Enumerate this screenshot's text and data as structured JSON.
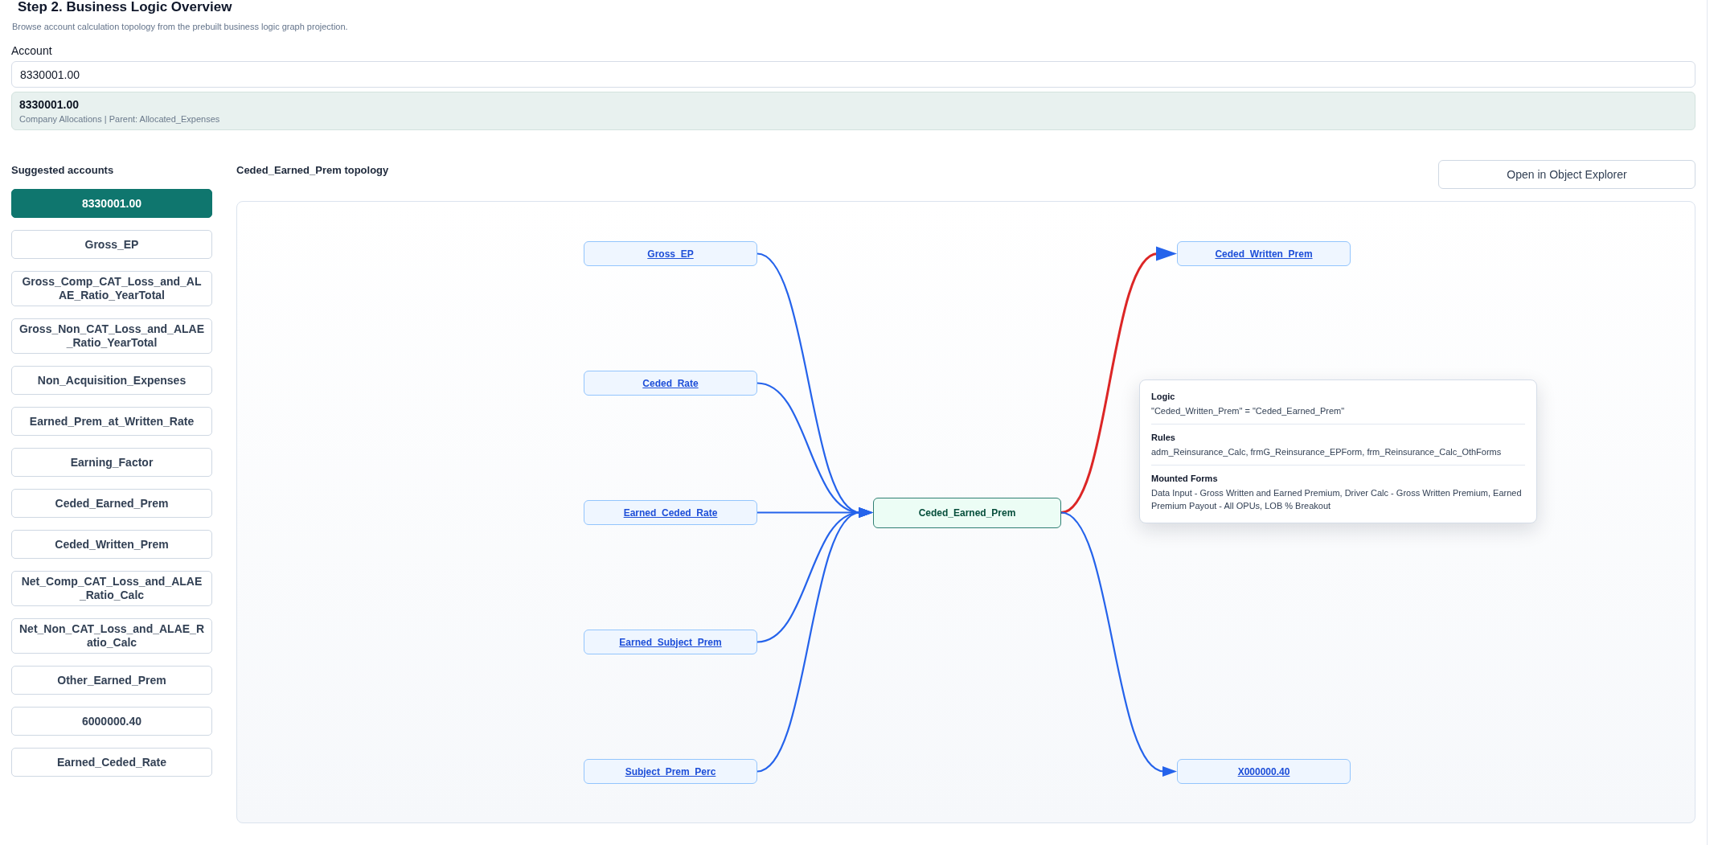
{
  "page": {
    "title": "Step 2. Business Logic Overview",
    "subtitle": "Browse account calculation topology from the prebuilt business logic graph projection."
  },
  "account": {
    "label": "Account",
    "value": "8330001.00",
    "match": {
      "name": "8330001.00",
      "detail": "Company Allocations | Parent: Allocated_Expenses"
    }
  },
  "suggested_accounts": {
    "heading": "Suggested accounts",
    "items": [
      {
        "label": "8330001.00",
        "selected": true
      },
      {
        "label": "Gross_EP",
        "selected": false
      },
      {
        "label": "Gross_Comp_CAT_Loss_and_ALAE_Ratio_YearTotal",
        "selected": false
      },
      {
        "label": "Gross_Non_CAT_Loss_and_ALAE_Ratio_YearTotal",
        "selected": false
      },
      {
        "label": "Non_Acquisition_Expenses",
        "selected": false
      },
      {
        "label": "Earned_Prem_at_Written_Rate",
        "selected": false
      },
      {
        "label": "Earning_Factor",
        "selected": false
      },
      {
        "label": "Ceded_Earned_Prem",
        "selected": false
      },
      {
        "label": "Ceded_Written_Prem",
        "selected": false
      },
      {
        "label": "Net_Comp_CAT_Loss_and_ALAE_Ratio_Calc",
        "selected": false
      },
      {
        "label": "Net_Non_CAT_Loss_and_ALAE_Ratio_Calc",
        "selected": false
      },
      {
        "label": "Other_Earned_Prem",
        "selected": false
      },
      {
        "label": "6000000.40",
        "selected": false
      },
      {
        "label": "Earned_Ceded_Rate",
        "selected": false
      }
    ]
  },
  "topology": {
    "title": "Ceded_Earned_Prem topology",
    "open_button": "Open in Object Explorer",
    "focus": {
      "label": "Ceded_Earned_Prem"
    },
    "inputs": [
      {
        "label": "Gross_EP",
        "highlighted": false
      },
      {
        "label": "Ceded_Rate",
        "highlighted": false
      },
      {
        "label": "Earned_Ceded_Rate",
        "highlighted": false
      },
      {
        "label": "Earned_Subject_Prem",
        "highlighted": false
      },
      {
        "label": "Subject_Prem_Perc",
        "highlighted": false
      }
    ],
    "outputs": [
      {
        "label": "Ceded_Written_Prem",
        "highlighted": true
      },
      {
        "label": "X000000.40",
        "highlighted": false
      }
    ],
    "tooltip": {
      "sections": [
        {
          "heading": "Logic",
          "text": "\"Ceded_Written_Prem\" = \"Ceded_Earned_Prem\""
        },
        {
          "heading": "Rules",
          "text": "adm_Reinsurance_Calc, frmG_Reinsurance_EPForm, frm_Reinsurance_Calc_OthForms"
        },
        {
          "heading": "Mounted Forms",
          "text": "Data Input - Gross Written and Earned Premium, Driver Calc - Gross Written Premium, Earned Premium Payout - All OPUs, LOB % Breakout"
        }
      ]
    }
  }
}
